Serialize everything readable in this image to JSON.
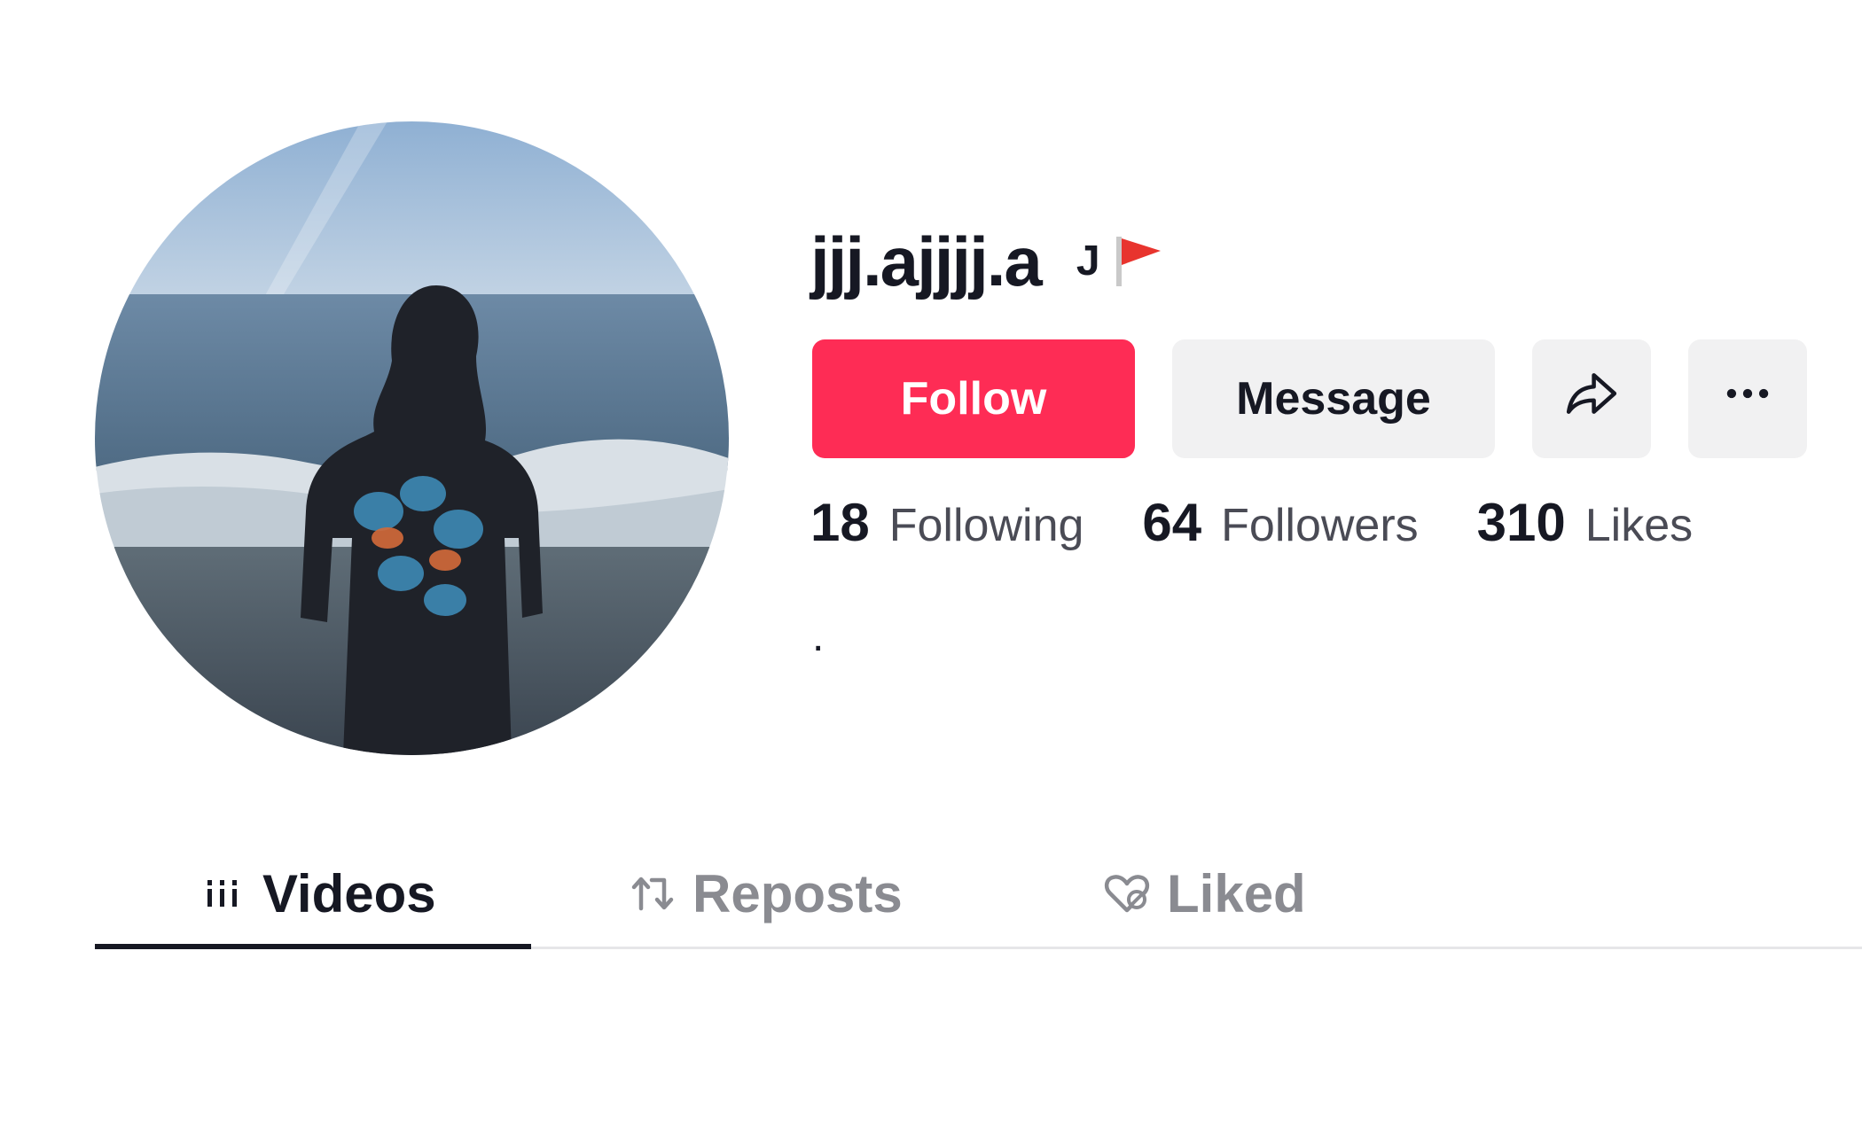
{
  "profile": {
    "username": "jjj.ajjjj.a",
    "nickname": "J",
    "flag_icon": "red-flag-emoji",
    "bio": "."
  },
  "actions": {
    "follow_label": "Follow",
    "message_label": "Message",
    "share_icon": "share-arrow-icon",
    "more_icon": "more-ellipsis-icon"
  },
  "stats": {
    "following": {
      "value": "18",
      "label": "Following"
    },
    "followers": {
      "value": "64",
      "label": "Followers"
    },
    "likes": {
      "value": "310",
      "label": "Likes"
    }
  },
  "tabs": [
    {
      "label": "Videos",
      "icon": "grid-icon",
      "active": true
    },
    {
      "label": "Reposts",
      "icon": "repost-icon",
      "active": false
    },
    {
      "label": "Liked",
      "icon": "heart-icon",
      "active": false
    }
  ],
  "colors": {
    "brand": "#fe2c55",
    "text": "#161823",
    "secondary_bg": "#f1f1f2",
    "muted_text": "#8a8b91"
  }
}
